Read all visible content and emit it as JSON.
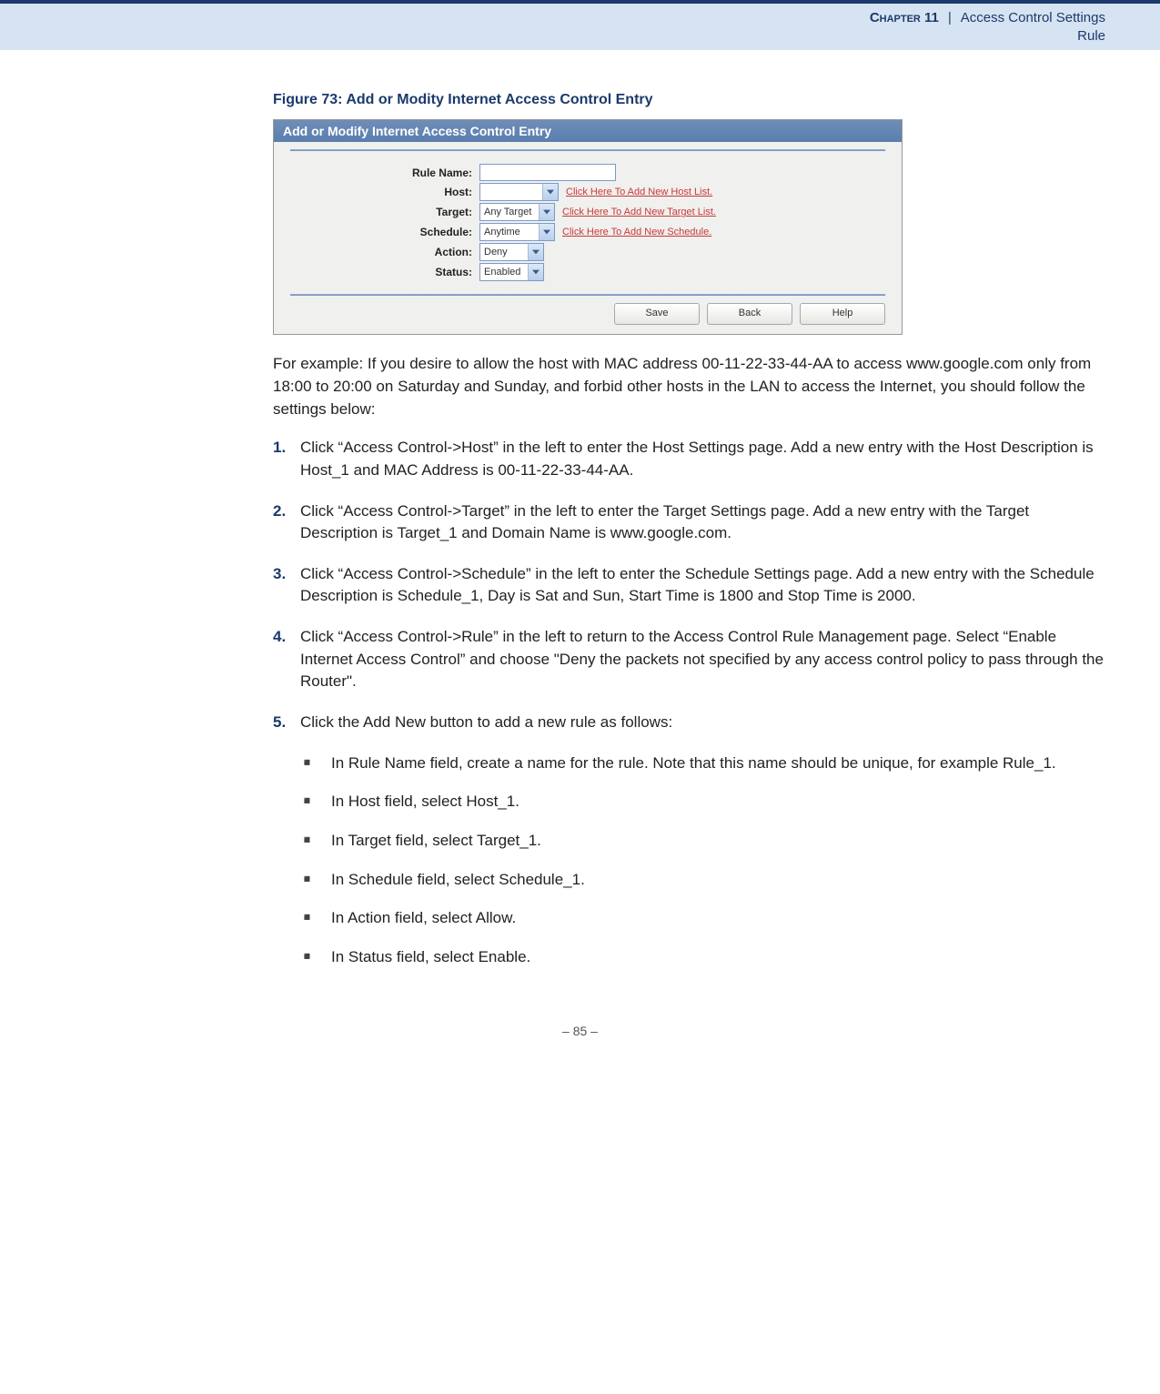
{
  "header": {
    "chapter_label": "Chapter",
    "chapter_num": "11",
    "separator": "|",
    "title": "Access Control Settings",
    "subtitle": "Rule"
  },
  "figure": {
    "caption": "Figure 73:  Add or Modity Internet Access Control Entry"
  },
  "dialog": {
    "title": "Add or Modify Internet Access Control Entry",
    "labels": {
      "rule_name": "Rule Name:",
      "host": "Host:",
      "target": "Target:",
      "schedule": "Schedule:",
      "action": "Action:",
      "status": "Status:"
    },
    "values": {
      "rule_name": "",
      "host": "",
      "target": "Any Target",
      "schedule": "Anytime",
      "action": "Deny",
      "status": "Enabled"
    },
    "links": {
      "host": "Click Here To Add New Host List.",
      "target": "Click Here To Add New Target List.",
      "schedule": "Click Here To Add New Schedule."
    },
    "buttons": {
      "save": "Save",
      "back": "Back",
      "help": "Help"
    }
  },
  "example_intro": "For example: If you desire to allow the host with MAC address 00-11-22-33-44-AA to access www.google.com only from 18:00 to 20:00 on Saturday and Sunday, and forbid other hosts in the LAN to access the Internet, you should follow the settings below:",
  "steps": [
    "Click “Access Control->Host” in the left to enter the Host Settings page. Add a new entry with the Host Description is Host_1 and MAC Address is 00-11-22-33-44-AA.",
    "Click “Access Control->Target” in the left to enter the Target Settings page. Add a new entry with the Target Description is Target_1 and Domain Name is www.google.com.",
    "Click “Access Control->Schedule” in the left to enter the Schedule Settings page. Add a new entry with the Schedule Description is Schedule_1, Day is Sat and Sun, Start Time is 1800 and Stop Time is 2000.",
    "Click “Access Control->Rule” in the left to return to the Access Control Rule Management page. Select “Enable Internet Access Control” and choose \"Deny the packets not specified by any access control policy to pass through the Router\".",
    "Click the Add New button to add a new rule as follows:"
  ],
  "sub_bullets": [
    "In Rule Name field, create a name for the rule. Note that this name should be unique, for example Rule_1.",
    "In Host field, select Host_1.",
    "In Target field, select Target_1.",
    "In Schedule field, select Schedule_1.",
    "In Action field, select Allow.",
    "In Status field, select Enable."
  ],
  "footer": {
    "page": "–  85  –"
  }
}
